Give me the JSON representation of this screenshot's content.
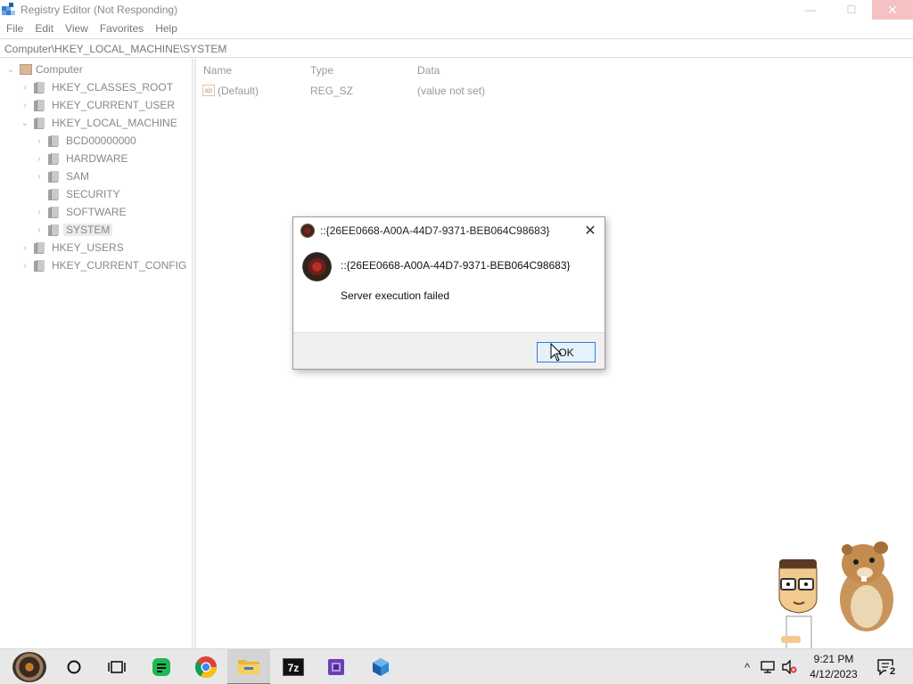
{
  "window": {
    "title": "Registry Editor (Not Responding)",
    "close_glyph": "✕",
    "minimize_glyph": "—",
    "maximize_glyph": "☐"
  },
  "menu": [
    "File",
    "Edit",
    "View",
    "Favorites",
    "Help"
  ],
  "address": "Computer\\HKEY_LOCAL_MACHINE\\SYSTEM",
  "tree": {
    "root": "Computer",
    "nodes": [
      {
        "label": "HKEY_CLASSES_ROOT",
        "level": 1,
        "chevron": "›"
      },
      {
        "label": "HKEY_CURRENT_USER",
        "level": 1,
        "chevron": "›"
      },
      {
        "label": "HKEY_LOCAL_MACHINE",
        "level": 1,
        "chevron": "⌄"
      },
      {
        "label": "BCD00000000",
        "level": 2,
        "chevron": "›"
      },
      {
        "label": "HARDWARE",
        "level": 2,
        "chevron": "›"
      },
      {
        "label": "SAM",
        "level": 2,
        "chevron": "›"
      },
      {
        "label": "SECURITY",
        "level": 2,
        "chevron": ""
      },
      {
        "label": "SOFTWARE",
        "level": 2,
        "chevron": "›"
      },
      {
        "label": "SYSTEM",
        "level": 2,
        "chevron": "›",
        "selected": true
      },
      {
        "label": "HKEY_USERS",
        "level": 1,
        "chevron": "›"
      },
      {
        "label": "HKEY_CURRENT_CONFIG",
        "level": 1,
        "chevron": "›"
      }
    ]
  },
  "list": {
    "headers": {
      "name": "Name",
      "type": "Type",
      "data": "Data"
    },
    "rows": [
      {
        "icon": "ab",
        "name": "(Default)",
        "type": "REG_SZ",
        "data": "(value not set)"
      }
    ]
  },
  "dialog": {
    "title": "::{26EE0668-A00A-44D7-9371-BEB064C98683}",
    "heading": "::{26EE0668-A00A-44D7-9371-BEB064C98683}",
    "message": "Server execution failed",
    "ok_label": "OK",
    "close_glyph": "✕"
  },
  "taskbar": {
    "icons": [
      "start-orb-icon",
      "search-circle-icon",
      "task-view-icon",
      "green-chat-app-icon",
      "chrome-icon",
      "file-explorer-icon",
      "7zip-icon",
      "cpu-app-icon",
      "cube-app-icon"
    ],
    "seven_zip_label": "7z",
    "tray": {
      "chevron": "^",
      "notifications_badge": "2"
    },
    "clock": {
      "time": "9:21 PM",
      "date": "4/12/2023"
    }
  },
  "colors": {
    "accent": "#2f7ed8",
    "ok_button_bg": "#e5f1fb",
    "taskbar_bg": "#e8e8e8"
  }
}
